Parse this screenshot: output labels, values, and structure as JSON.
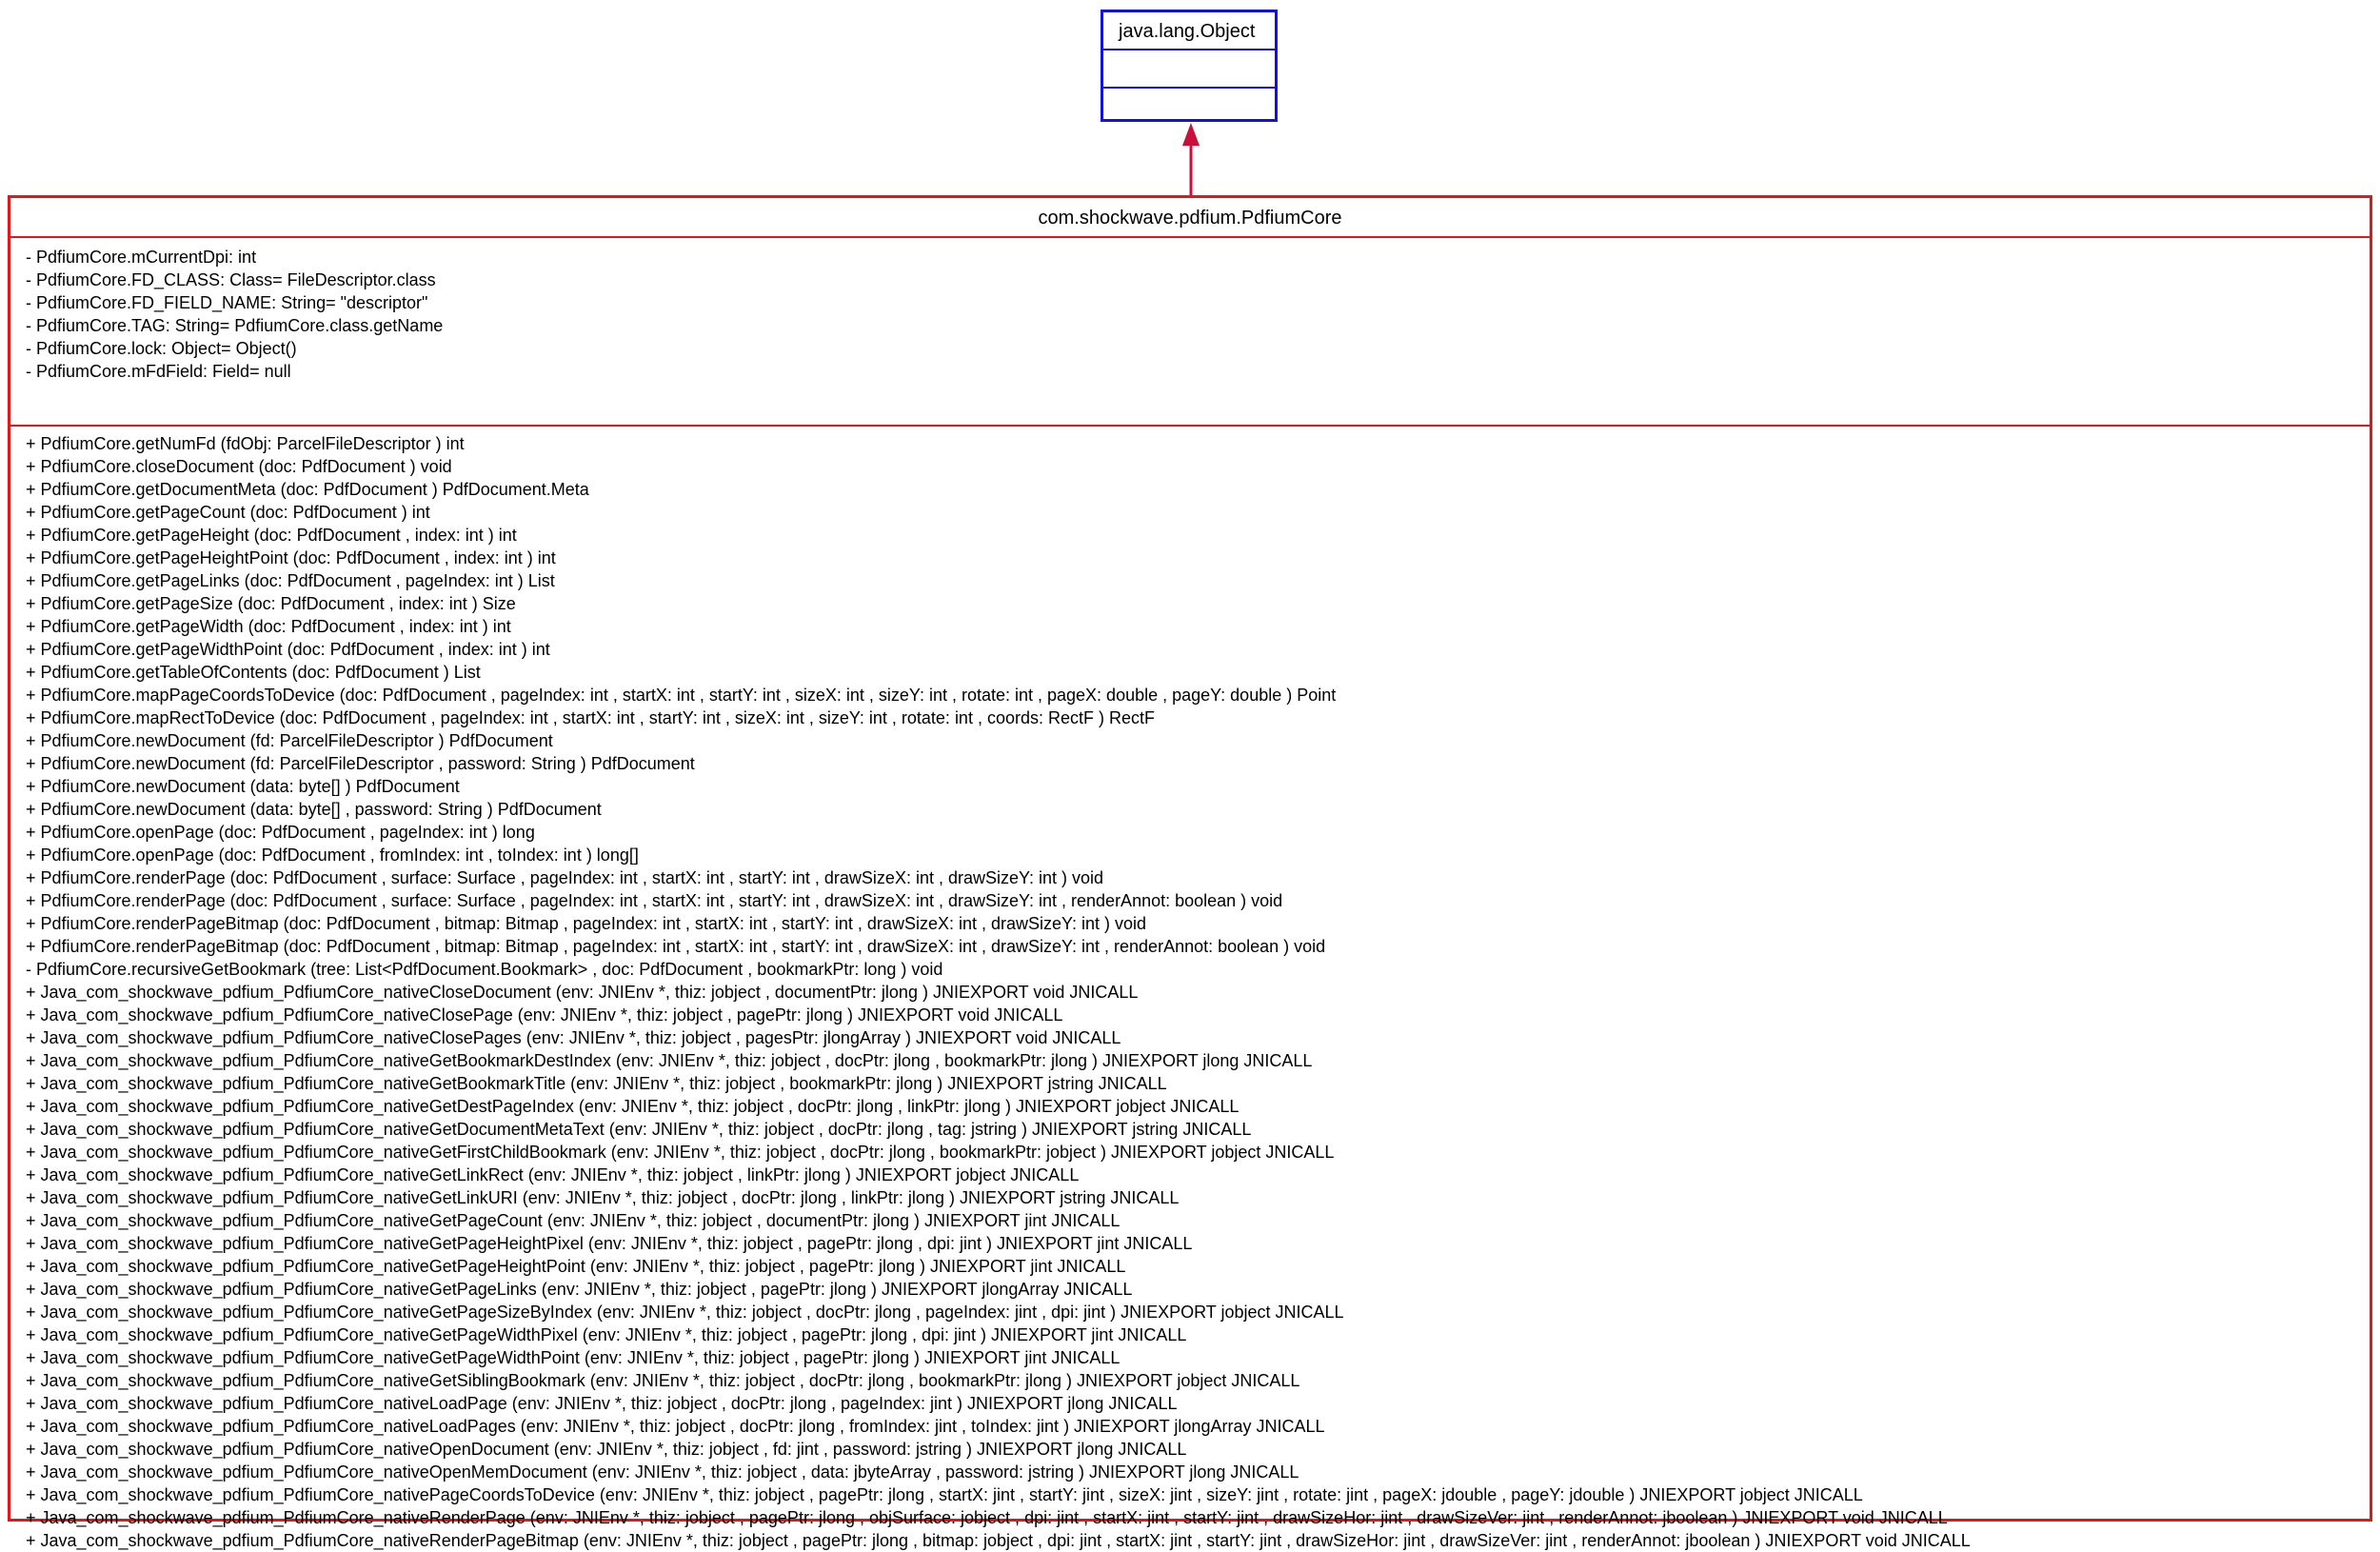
{
  "parent_class": {
    "name": "java.lang.Object"
  },
  "class": {
    "name": "com.shockwave.pdfium.PdfiumCore",
    "attributes": [
      "- PdfiumCore.mCurrentDpi: int",
      "- PdfiumCore.FD_CLASS: Class= FileDescriptor.class",
      "- PdfiumCore.FD_FIELD_NAME: String= \"descriptor\"",
      "- PdfiumCore.TAG: String= PdfiumCore.class.getName",
      "- PdfiumCore.lock: Object= Object()",
      "- PdfiumCore.mFdField: Field= null"
    ],
    "operations": [
      "+ PdfiumCore.getNumFd (fdObj: ParcelFileDescriptor ) int",
      "+ PdfiumCore.closeDocument (doc: PdfDocument ) void",
      "+ PdfiumCore.getDocumentMeta (doc: PdfDocument ) PdfDocument.Meta",
      "+ PdfiumCore.getPageCount (doc: PdfDocument ) int",
      "+ PdfiumCore.getPageHeight (doc: PdfDocument , index: int ) int",
      "+ PdfiumCore.getPageHeightPoint (doc: PdfDocument , index: int ) int",
      "+ PdfiumCore.getPageLinks (doc: PdfDocument , pageIndex: int ) List",
      "+ PdfiumCore.getPageSize (doc: PdfDocument , index: int ) Size",
      "+ PdfiumCore.getPageWidth (doc: PdfDocument , index: int ) int",
      "+ PdfiumCore.getPageWidthPoint (doc: PdfDocument , index: int ) int",
      "+ PdfiumCore.getTableOfContents (doc: PdfDocument ) List",
      "+ PdfiumCore.mapPageCoordsToDevice (doc: PdfDocument , pageIndex: int , startX: int , startY: int , sizeX: int , sizeY: int , rotate: int , pageX: double , pageY: double ) Point",
      "+ PdfiumCore.mapRectToDevice (doc: PdfDocument , pageIndex: int , startX: int , startY: int , sizeX: int , sizeY: int , rotate: int , coords: RectF ) RectF",
      "+ PdfiumCore.newDocument (fd: ParcelFileDescriptor ) PdfDocument",
      "+ PdfiumCore.newDocument (fd: ParcelFileDescriptor , password: String ) PdfDocument",
      "+ PdfiumCore.newDocument (data: byte[] ) PdfDocument",
      "+ PdfiumCore.newDocument (data: byte[] , password: String ) PdfDocument",
      "+ PdfiumCore.openPage (doc: PdfDocument , pageIndex: int ) long",
      "+ PdfiumCore.openPage (doc: PdfDocument , fromIndex: int , toIndex: int ) long[]",
      "+ PdfiumCore.renderPage (doc: PdfDocument , surface: Surface , pageIndex: int , startX: int , startY: int , drawSizeX: int , drawSizeY: int ) void",
      "+ PdfiumCore.renderPage (doc: PdfDocument , surface: Surface , pageIndex: int , startX: int , startY: int , drawSizeX: int , drawSizeY: int , renderAnnot: boolean ) void",
      "+ PdfiumCore.renderPageBitmap (doc: PdfDocument , bitmap: Bitmap , pageIndex: int , startX: int , startY: int , drawSizeX: int , drawSizeY: int ) void",
      "+ PdfiumCore.renderPageBitmap (doc: PdfDocument , bitmap: Bitmap , pageIndex: int , startX: int , startY: int , drawSizeX: int , drawSizeY: int , renderAnnot: boolean ) void",
      "- PdfiumCore.recursiveGetBookmark (tree: List<PdfDocument.Bookmark> , doc: PdfDocument , bookmarkPtr: long ) void",
      "+ Java_com_shockwave_pdfium_PdfiumCore_nativeCloseDocument (env: JNIEnv *, thiz: jobject , documentPtr: jlong ) JNIEXPORT void JNICALL",
      "+ Java_com_shockwave_pdfium_PdfiumCore_nativeClosePage (env: JNIEnv *, thiz: jobject , pagePtr: jlong ) JNIEXPORT void JNICALL",
      "+ Java_com_shockwave_pdfium_PdfiumCore_nativeClosePages (env: JNIEnv *, thiz: jobject , pagesPtr: jlongArray ) JNIEXPORT void JNICALL",
      "+ Java_com_shockwave_pdfium_PdfiumCore_nativeGetBookmarkDestIndex (env: JNIEnv *, thiz: jobject , docPtr: jlong , bookmarkPtr: jlong ) JNIEXPORT jlong JNICALL",
      "+ Java_com_shockwave_pdfium_PdfiumCore_nativeGetBookmarkTitle (env: JNIEnv *, thiz: jobject , bookmarkPtr: jlong ) JNIEXPORT jstring JNICALL",
      "+ Java_com_shockwave_pdfium_PdfiumCore_nativeGetDestPageIndex (env: JNIEnv *, thiz: jobject , docPtr: jlong , linkPtr: jlong ) JNIEXPORT jobject JNICALL",
      "+ Java_com_shockwave_pdfium_PdfiumCore_nativeGetDocumentMetaText (env: JNIEnv *, thiz: jobject , docPtr: jlong , tag: jstring ) JNIEXPORT jstring JNICALL",
      "+ Java_com_shockwave_pdfium_PdfiumCore_nativeGetFirstChildBookmark (env: JNIEnv *, thiz: jobject , docPtr: jlong , bookmarkPtr: jobject ) JNIEXPORT jobject JNICALL",
      "+ Java_com_shockwave_pdfium_PdfiumCore_nativeGetLinkRect (env: JNIEnv *, thiz: jobject , linkPtr: jlong ) JNIEXPORT jobject JNICALL",
      "+ Java_com_shockwave_pdfium_PdfiumCore_nativeGetLinkURI (env: JNIEnv *, thiz: jobject , docPtr: jlong , linkPtr: jlong ) JNIEXPORT jstring JNICALL",
      "+ Java_com_shockwave_pdfium_PdfiumCore_nativeGetPageCount (env: JNIEnv *, thiz: jobject , documentPtr: jlong ) JNIEXPORT jint JNICALL",
      "+ Java_com_shockwave_pdfium_PdfiumCore_nativeGetPageHeightPixel (env: JNIEnv *, thiz: jobject , pagePtr: jlong , dpi: jint ) JNIEXPORT jint JNICALL",
      "+ Java_com_shockwave_pdfium_PdfiumCore_nativeGetPageHeightPoint (env: JNIEnv *, thiz: jobject , pagePtr: jlong ) JNIEXPORT jint JNICALL",
      "+ Java_com_shockwave_pdfium_PdfiumCore_nativeGetPageLinks (env: JNIEnv *, thiz: jobject , pagePtr: jlong ) JNIEXPORT jlongArray JNICALL",
      "+ Java_com_shockwave_pdfium_PdfiumCore_nativeGetPageSizeByIndex (env: JNIEnv *, thiz: jobject , docPtr: jlong , pageIndex: jint , dpi: jint ) JNIEXPORT jobject JNICALL",
      "+ Java_com_shockwave_pdfium_PdfiumCore_nativeGetPageWidthPixel (env: JNIEnv *, thiz: jobject , pagePtr: jlong , dpi: jint ) JNIEXPORT jint JNICALL",
      "+ Java_com_shockwave_pdfium_PdfiumCore_nativeGetPageWidthPoint (env: JNIEnv *, thiz: jobject , pagePtr: jlong ) JNIEXPORT jint JNICALL",
      "+ Java_com_shockwave_pdfium_PdfiumCore_nativeGetSiblingBookmark (env: JNIEnv *, thiz: jobject , docPtr: jlong , bookmarkPtr: jlong ) JNIEXPORT jobject JNICALL",
      "+ Java_com_shockwave_pdfium_PdfiumCore_nativeLoadPage (env: JNIEnv *, thiz: jobject , docPtr: jlong , pageIndex: jint ) JNIEXPORT jlong JNICALL",
      "+ Java_com_shockwave_pdfium_PdfiumCore_nativeLoadPages (env: JNIEnv *, thiz: jobject , docPtr: jlong , fromIndex: jint , toIndex: jint ) JNIEXPORT jlongArray JNICALL",
      "+ Java_com_shockwave_pdfium_PdfiumCore_nativeOpenDocument (env: JNIEnv *, thiz: jobject , fd: jint , password: jstring ) JNIEXPORT jlong JNICALL",
      "+ Java_com_shockwave_pdfium_PdfiumCore_nativeOpenMemDocument (env: JNIEnv *, thiz: jobject , data: jbyteArray , password: jstring ) JNIEXPORT jlong JNICALL",
      "+ Java_com_shockwave_pdfium_PdfiumCore_nativePageCoordsToDevice (env: JNIEnv *, thiz: jobject , pagePtr: jlong , startX: jint , startY: jint , sizeX: jint , sizeY: jint , rotate: jint , pageX: jdouble , pageY: jdouble ) JNIEXPORT jobject JNICALL",
      "+ Java_com_shockwave_pdfium_PdfiumCore_nativeRenderPage (env: JNIEnv *, thiz: jobject , pagePtr: jlong , objSurface: jobject , dpi: jint , startX: jint , startY: jint , drawSizeHor: jint , drawSizeVer: jint , renderAnnot: jboolean ) JNIEXPORT void JNICALL",
      "+ Java_com_shockwave_pdfium_PdfiumCore_nativeRenderPageBitmap (env: JNIEnv *, thiz: jobject , pagePtr: jlong , bitmap: jobject , dpi: jint , startX: jint , startY: jint , drawSizeHor: jint , drawSizeVer: jint , renderAnnot: jboolean ) JNIEXPORT void JNICALL"
    ]
  },
  "colors": {
    "parent_border": "#1212e0",
    "class_border": "#e01818",
    "arrow": "#c8103a"
  }
}
